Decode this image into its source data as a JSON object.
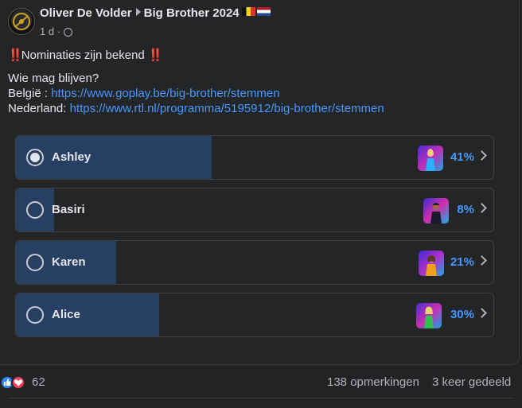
{
  "header": {
    "author": "Oliver De Volder",
    "group": "Big Brother 2024",
    "time": "1 d",
    "separator": "·"
  },
  "post": {
    "headline_bang_left": "‼️",
    "headline": "Nominaties zijn bekend",
    "headline_bang_right": "‼️",
    "question": "Wie mag blijven?",
    "belgium_label": "België : ",
    "belgium_link": "https://www.goplay.be/big-brother/stemmen",
    "netherlands_label": "Nederland: ",
    "netherlands_link": "https://www.rtl.nl/programma/5195912/big-brother/stemmen"
  },
  "poll": {
    "options": [
      {
        "label": "Ashley",
        "percent_text": "41%",
        "percent": 41,
        "selected": true
      },
      {
        "label": "Basiri",
        "percent_text": "8%",
        "percent": 8,
        "selected": false
      },
      {
        "label": "Karen",
        "percent_text": "21%",
        "percent": 21,
        "selected": false
      },
      {
        "label": "Alice",
        "percent_text": "30%",
        "percent": 30,
        "selected": false
      }
    ]
  },
  "footer": {
    "reaction_count": "62",
    "comments": "138 opmerkingen",
    "shares": "3 keer gedeeld"
  },
  "colors": {
    "background": "#242526",
    "fill": "#263f63",
    "accent": "#4599ff",
    "text": "#e4e6eb",
    "muted": "#b0b3b8"
  }
}
